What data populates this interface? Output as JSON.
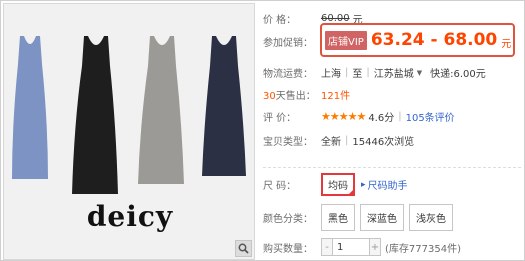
{
  "brand": {
    "name": "deicy"
  },
  "price": {
    "label": "价  格：",
    "value": "60.00",
    "unit": "元"
  },
  "promo": {
    "label": "参加促销：",
    "tag": "店铺VIP",
    "range": "63.24 - 68.00",
    "unit": "元"
  },
  "shipping": {
    "label": "物流运费：",
    "from": "上海",
    "to_label": "至",
    "to": "江苏盐城",
    "method": "快递:6.00元"
  },
  "sales": {
    "label_num": "30",
    "label_rest": "天售出：",
    "count": "121件"
  },
  "rating": {
    "label": "评  价：",
    "stars": "★★★★★",
    "score": "4.6分",
    "reviews": "105条评价"
  },
  "condition": {
    "label": "宝贝类型：",
    "type": "全新",
    "views": "15446次浏览"
  },
  "size": {
    "label": "尺  码：",
    "selected": "均码",
    "helper": "尺码助手"
  },
  "colors": {
    "label": "颜色分类：",
    "options": [
      "黑色",
      "深蓝色",
      "浅灰色"
    ]
  },
  "quantity": {
    "label": "购买数量：",
    "minus": "-",
    "value": "1",
    "plus": "+",
    "stock": "(库存777354件)"
  },
  "dress_colors": [
    "#7d93c4",
    "#1e1e1e",
    "#9b9a96",
    "#2b3045"
  ]
}
